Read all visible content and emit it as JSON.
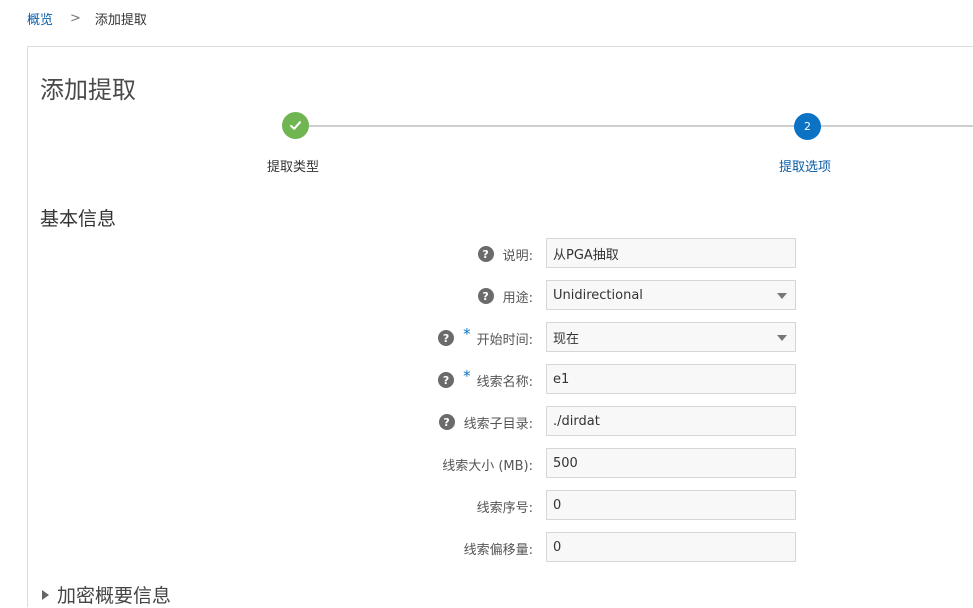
{
  "breadcrumb": {
    "root": "概览",
    "separator": ">",
    "current": "添加提取"
  },
  "page_title": "添加提取",
  "train": {
    "step1_label": "提取类型",
    "step2_number": "2",
    "step2_label": "提取选项",
    "colors": {
      "completed": "#6fb552",
      "active": "#0b72c4"
    }
  },
  "section_title": "基本信息",
  "form": {
    "description": {
      "label": "说明:",
      "value": "从PGA抽取"
    },
    "purpose": {
      "label": "用途:",
      "value": "Unidirectional"
    },
    "start_time": {
      "required_mark": "*",
      "label": "开始时间:",
      "value": "现在"
    },
    "trail_name": {
      "required_mark": "*",
      "label": "线索名称:",
      "value": "e1"
    },
    "trail_subdir": {
      "label": "线索子目录:",
      "value": "./dirdat"
    },
    "trail_size": {
      "label": "线索大小 (MB):",
      "value": "500"
    },
    "trail_seq": {
      "label": "线索序号:",
      "value": "0"
    },
    "trail_offset": {
      "label": "线索偏移量:",
      "value": "0"
    }
  },
  "collapsed_section": "加密概要信息",
  "icons": {
    "help": "help-icon",
    "check": "check-icon",
    "dropdown": "chevron-down-icon",
    "expand": "expand-triangle-icon"
  }
}
